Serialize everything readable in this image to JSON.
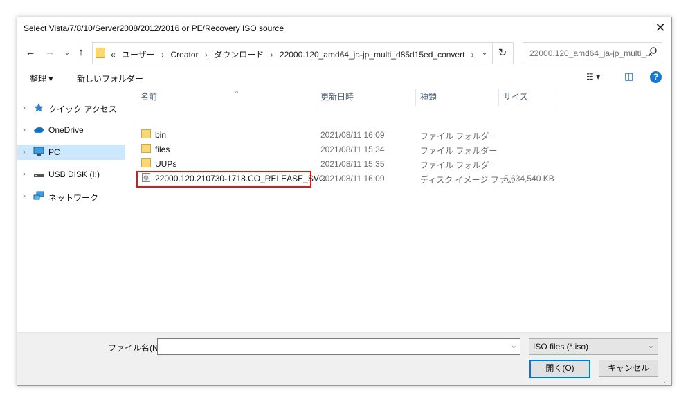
{
  "window": {
    "title": "Select Vista/7/8/10/Server2008/2012/2016 or PE/Recovery ISO source",
    "close_glyph": "✕"
  },
  "nav_buttons": {
    "back": "←",
    "forward": "→",
    "recent": "⌄",
    "up": "↑"
  },
  "address": {
    "overflow": "«",
    "crumbs": [
      "ユーザー",
      "Creator",
      "ダウンロード",
      "22000.120_amd64_ja-jp_multi_d85d15ed_convert"
    ],
    "separator": "›",
    "dropdown_glyph": "⌄",
    "refresh_glyph": "↻"
  },
  "search": {
    "placeholder": "22000.120_amd64_ja-jp_multi_...",
    "icon": "search-icon"
  },
  "toolbar": {
    "organize": "整理 ▾",
    "new_folder": "新しいフォルダー",
    "views": "☷ ▾",
    "preview_pane": "◫",
    "help": "?"
  },
  "sidebar": {
    "items": [
      {
        "label": "クイック アクセス",
        "icon": "star-icon",
        "expand": "›"
      },
      {
        "label": "OneDrive",
        "icon": "cloud-icon",
        "expand": "›"
      },
      {
        "label": "PC",
        "icon": "computer-icon",
        "expand": "›",
        "selected": true
      },
      {
        "label": "USB DISK (I:)",
        "icon": "usb-drive-icon",
        "expand": "›"
      },
      {
        "label": "ネットワーク",
        "icon": "network-icon",
        "expand": "›"
      }
    ]
  },
  "columns": {
    "name": "名前",
    "date": "更新日時",
    "type": "種類",
    "size": "サイズ",
    "sort_glyph": "^"
  },
  "files": [
    {
      "name": "bin",
      "date": "2021/08/11 16:09",
      "type": "ファイル フォルダー",
      "size": "",
      "icon": "folder-icon"
    },
    {
      "name": "files",
      "date": "2021/08/11 15:34",
      "type": "ファイル フォルダー",
      "size": "",
      "icon": "folder-icon"
    },
    {
      "name": "UUPs",
      "date": "2021/08/11 15:35",
      "type": "ファイル フォルダー",
      "size": "",
      "icon": "folder-icon"
    },
    {
      "name": "22000.120.210730-1718.CO_RELEASE_SVC...",
      "date": "2021/08/11 16:09",
      "type": "ディスク イメージ ファ...",
      "size": "5,634,540 KB",
      "icon": "disc-image-icon",
      "highlighted": true
    }
  ],
  "footer": {
    "filename_label": "ファイル名(N):",
    "filename_value": "",
    "dropdown_glyph": "⌄",
    "filetype": "ISO files (*.iso)",
    "open_button": "開く(O)",
    "cancel_button": "キャンセル",
    "grip": "⋰"
  },
  "colors": {
    "highlight_border": "#e0161b",
    "selection": "#cce8ff",
    "accent": "#0078d7",
    "folder": "#f8d775"
  }
}
